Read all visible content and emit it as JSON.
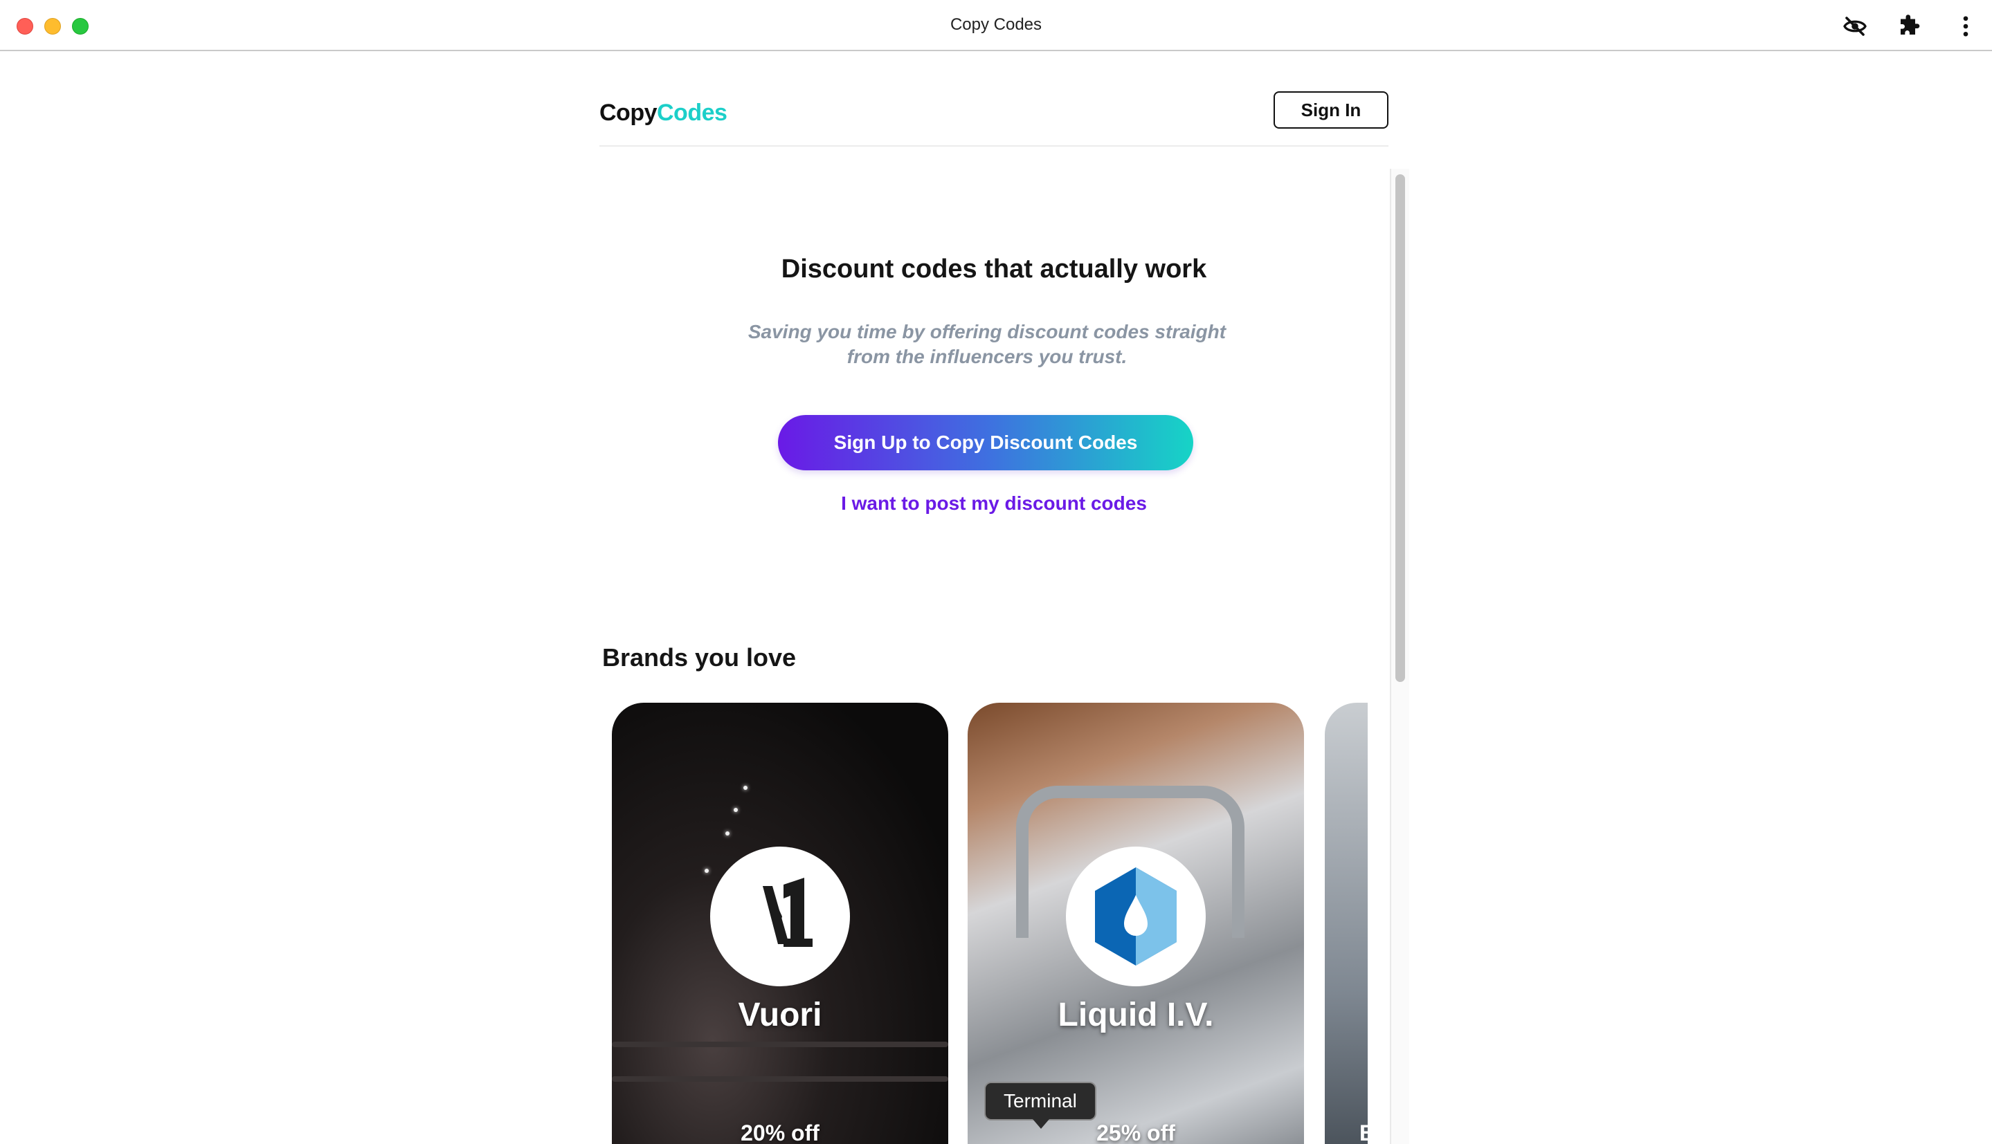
{
  "window": {
    "title": "Copy Codes",
    "icons": [
      "eye-slash-icon",
      "puzzle-icon",
      "kebab-menu-icon"
    ]
  },
  "header": {
    "logo_part1": "Copy",
    "logo_part2": "Codes",
    "signin_label": "Sign In"
  },
  "hero": {
    "title": "Discount codes that actually work",
    "subtitle": "Saving you time by offering discount codes straight from the influencers you trust.",
    "cta_label": "Sign Up to Copy Discount Codes",
    "post_link": "I want to post my discount codes"
  },
  "brands": {
    "heading": "Brands you love",
    "items": [
      {
        "name": "Vuori",
        "offer": "20% off"
      },
      {
        "name": "Liquid I.V.",
        "offer": "25% off"
      },
      {
        "offer": "B"
      }
    ]
  },
  "tooltip": {
    "text": "Terminal"
  },
  "colors": {
    "brand_teal": "#1ccfc9",
    "brand_purple": "#6a1ae6",
    "subtitle_gray": "#8a95a3"
  }
}
